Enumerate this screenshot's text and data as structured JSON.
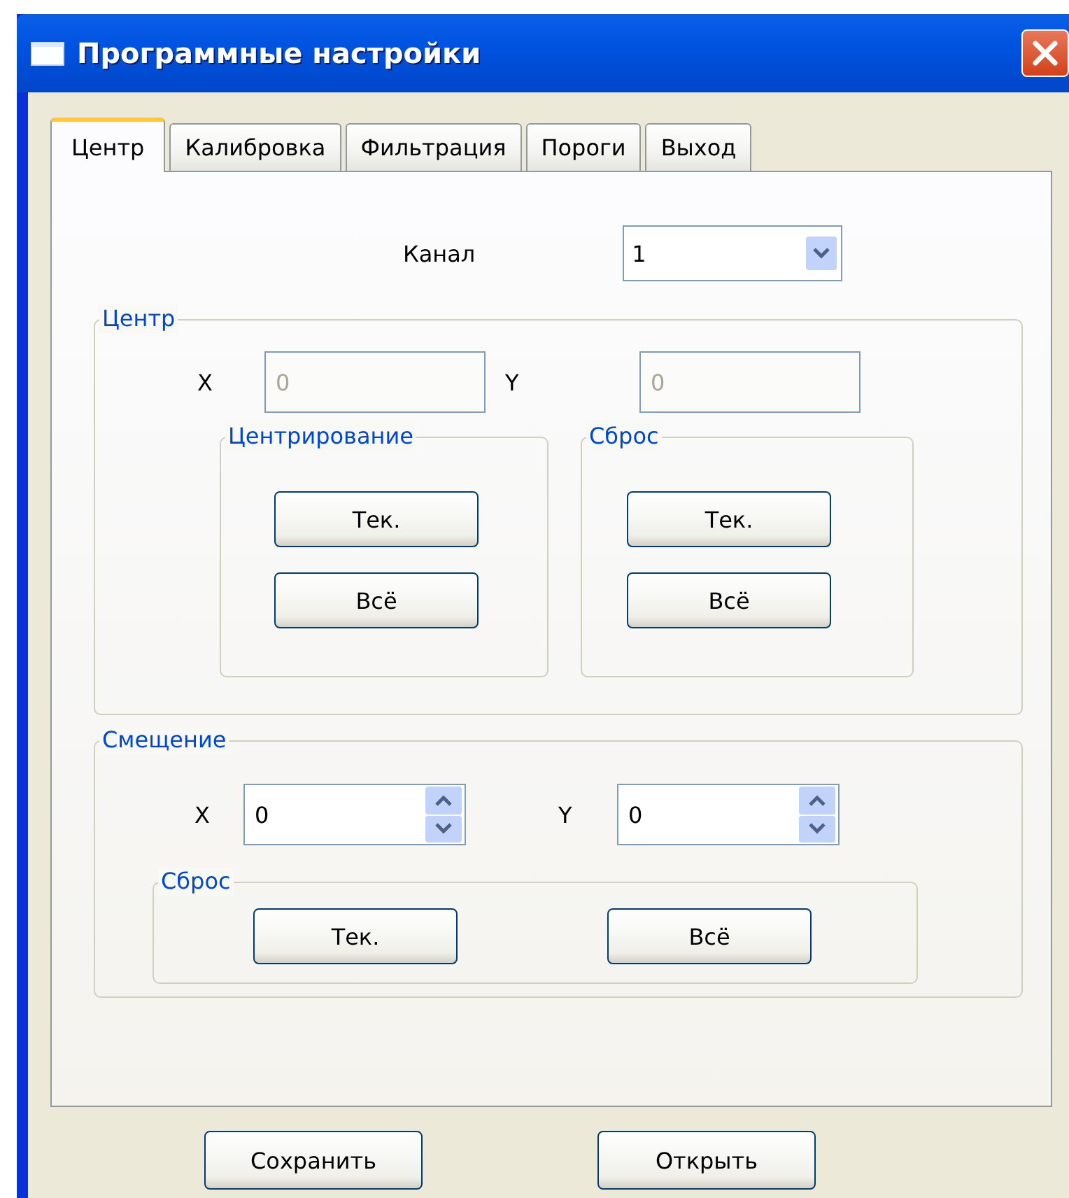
{
  "window": {
    "title": "Программные настройки"
  },
  "tabs": [
    {
      "label": "Центр",
      "selected": true
    },
    {
      "label": "Калибровка",
      "selected": false
    },
    {
      "label": "Фильтрация",
      "selected": false
    },
    {
      "label": "Пороги",
      "selected": false
    },
    {
      "label": "Выход",
      "selected": false
    }
  ],
  "channel": {
    "label": "Канал",
    "value": "1"
  },
  "center_group": {
    "title": "Центр",
    "x": {
      "label": "X",
      "value": "0",
      "disabled": true
    },
    "y": {
      "label": "Y",
      "value": "0",
      "disabled": true
    },
    "centering": {
      "title": "Центрирование",
      "buttons": [
        "Тек.",
        "Всё"
      ]
    },
    "reset": {
      "title": "Сброс",
      "buttons": [
        "Тек.",
        "Всё"
      ]
    }
  },
  "offset_group": {
    "title": "Смещение",
    "x": {
      "label": "X",
      "value": "0",
      "disabled": false
    },
    "y": {
      "label": "Y",
      "value": "0",
      "disabled": false
    },
    "reset": {
      "title": "Сброс",
      "buttons": [
        "Тек.",
        "Всё"
      ]
    }
  },
  "buttons": [
    "Сохранить",
    "Открыть"
  ]
}
